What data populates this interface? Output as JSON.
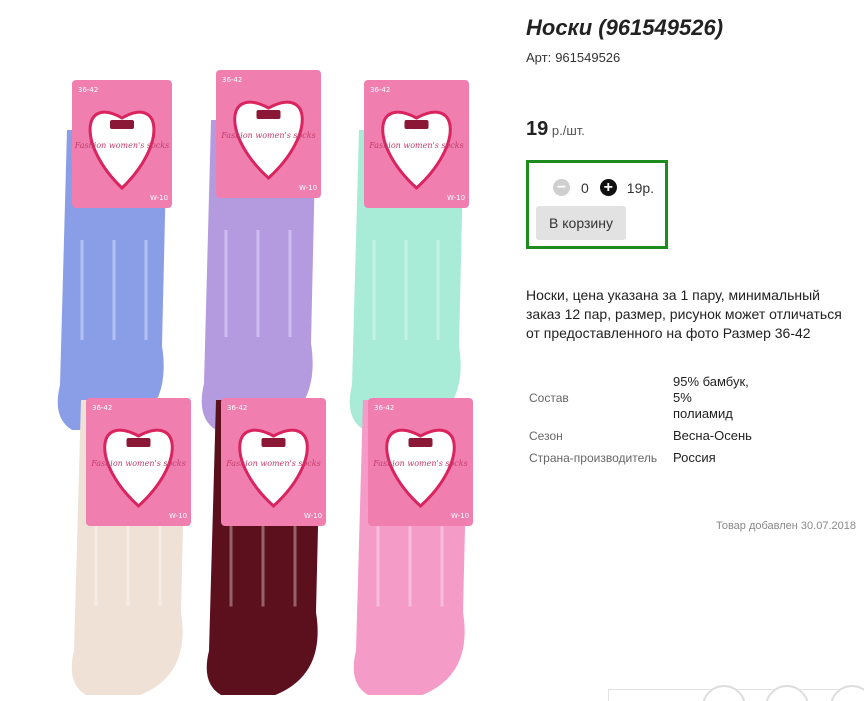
{
  "product": {
    "title": "Носки (961549526)",
    "art_label": "Арт:",
    "art_value": "961549526",
    "price_value": "19",
    "price_unit": "р./шт.",
    "description": "Носки, цена указана за 1 пару, минимальный заказ 12 пар, размер, рисунок может отличаться от предоставленного на фото Размер 36-42",
    "added": "Товар добавлен 30.07.2018"
  },
  "cart": {
    "minus_icon": "minus-icon",
    "plus_icon": "plus-icon",
    "quantity": "0",
    "line_total": "19р.",
    "button_label": "В корзину",
    "border_color": "#1e8b1e"
  },
  "properties": [
    {
      "name": "Состав",
      "value": "95% бамбук, 5% полиамид"
    },
    {
      "name": "Сезон",
      "value": "Весна-Осень"
    },
    {
      "name": "Страна-производитель",
      "value": "Россия"
    }
  ],
  "gallery": {
    "label_text": "Fashion women's socks",
    "size_text": "36-42",
    "code_text": "W-10",
    "sock_colors": [
      "#8a9ee8",
      "#b49be0",
      "#a8ecd8",
      "#efe1d6",
      "#5c0f1c",
      "#f49bc8"
    ],
    "card_color": "#f07fb0"
  },
  "bottom_icons": [
    "heart-icon",
    "close-icon",
    "share-icon"
  ]
}
